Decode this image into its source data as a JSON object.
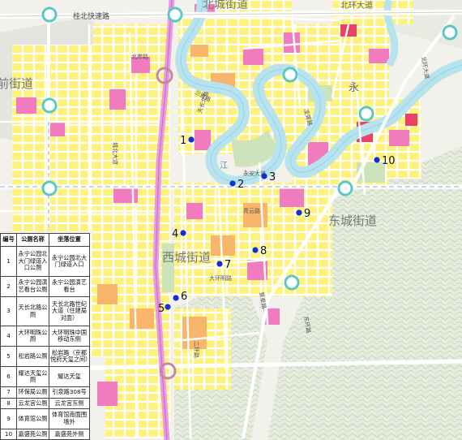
{
  "labels": {
    "top_road": "桂北快速路",
    "north_district": "北城街道",
    "ne_road": "北环大道",
    "beihuan_right": "北环大道",
    "left_district": "前街道",
    "yong": "永",
    "west_district": "西城街道",
    "east_district": "东城街道",
    "river_l": "江",
    "road_tianchang": "天长北路",
    "road_dahuan": "大环明路",
    "road_lan": "兰雅路",
    "road_qingyun": "青云路",
    "road_lingxiao": "凌霄路",
    "road_jingtai": "景泰路",
    "road_west_vertical": "城北大道",
    "road_south": "二环路",
    "road_se": "东环路",
    "road_mid_h": "永安大道",
    "road_west_h": "北岸路"
  },
  "markers": [
    {
      "num": "1"
    },
    {
      "num": "2"
    },
    {
      "num": "3"
    },
    {
      "num": "4"
    },
    {
      "num": "5"
    },
    {
      "num": "6"
    },
    {
      "num": "7"
    },
    {
      "num": "8"
    },
    {
      "num": "9"
    },
    {
      "num": "10"
    }
  ],
  "legend": {
    "headers": [
      "编号",
      "公厕名称",
      "坐落位置"
    ],
    "rows": [
      [
        "1",
        "永宁公园北大门绿道入口公厕",
        "永宁公园北大门绿道入口"
      ],
      [
        "2",
        "永宁公园演艺看台公厕",
        "永宁公园演艺看台"
      ],
      [
        "3",
        "天长北路公厕",
        "天长北路世纪大道（住建局对面）"
      ],
      [
        "4",
        "大环明珠公厕",
        "大环明珠中国移动东侧"
      ],
      [
        "5",
        "松岩路公厕",
        "松岩路（京都悦府天玺之间）"
      ],
      [
        "6",
        "耀达天玺公厕",
        "耀达天玺"
      ],
      [
        "7",
        "环保局公厕",
        "引泉路308号"
      ],
      [
        "8",
        "云龙宫公厕",
        "云龙宫东侧"
      ],
      [
        "9",
        "体育馆公厕",
        "体育馆南面围墙外"
      ],
      [
        "10",
        "嘉盛苑公厕",
        "嘉盛苑外侧"
      ]
    ]
  },
  "colors": {
    "yellow": "#fef27a",
    "orange": "#f7b66c",
    "pink": "#f07cbf",
    "red": "#e8426a",
    "river": "#b7e3ee",
    "highway": "#e79be0",
    "marker": "#1030d8",
    "station": "#5cc8c5",
    "green": "#cde3bb"
  }
}
